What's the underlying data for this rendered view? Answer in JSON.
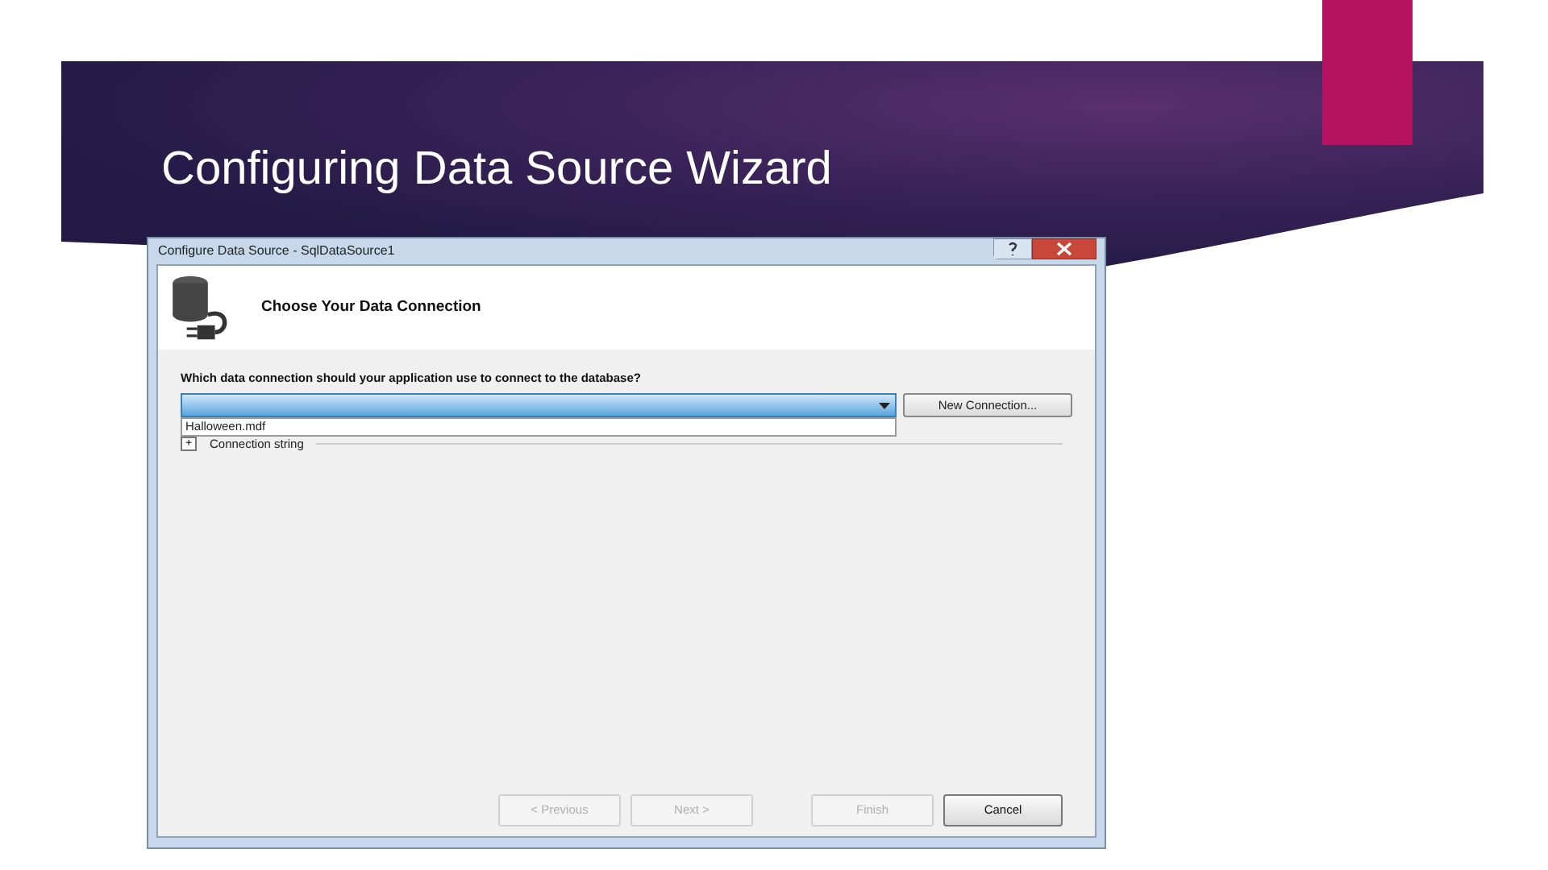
{
  "slide": {
    "title": "Configuring Data Source Wizard"
  },
  "dialog": {
    "title": "Configure Data Source - SqlDataSource1",
    "heading": "Choose Your Data Connection",
    "question": "Which data connection should your application use to connect to the database?",
    "connection_dropdown": {
      "expanded": true,
      "options": [
        {
          "label": "Halloween.mdf",
          "selected": false
        }
      ]
    },
    "new_connection_button": "New Connection...",
    "connection_string": {
      "toggle": "+",
      "label": "Connection string",
      "expanded": false
    },
    "buttons": [
      {
        "label": "< Previous",
        "disabled": true
      },
      {
        "label": "Next >",
        "disabled": true
      },
      {
        "label": "Finish",
        "disabled": true
      },
      {
        "label": "Cancel",
        "disabled": false
      }
    ]
  }
}
